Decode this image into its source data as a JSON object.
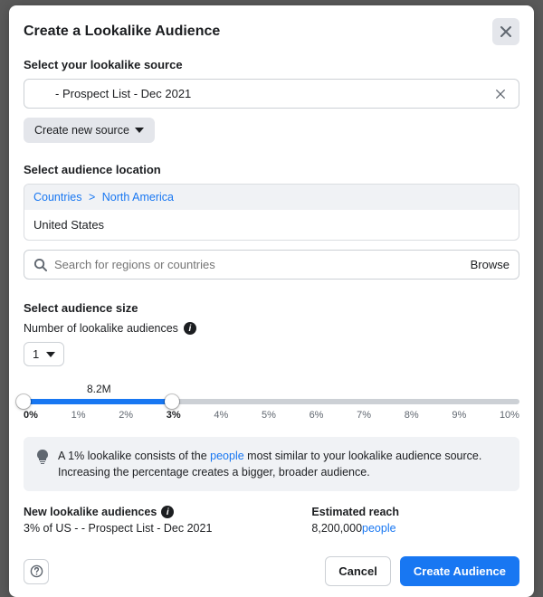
{
  "modal": {
    "title": "Create a Lookalike Audience"
  },
  "source": {
    "label": "Select your lookalike source",
    "value": "- Prospect List - Dec 2021",
    "create_label": "Create new source"
  },
  "location": {
    "label": "Select audience location",
    "breadcrumb_countries": "Countries",
    "breadcrumb_region": "North America",
    "country": "United States",
    "search_placeholder": "Search for regions or countries",
    "browse": "Browse"
  },
  "size": {
    "label": "Select audience size",
    "count_label": "Number of lookalike audiences",
    "count_value": "1",
    "slider_value": "8.2M",
    "ticks": [
      "0%",
      "1%",
      "2%",
      "3%",
      "4%",
      "5%",
      "6%",
      "7%",
      "8%",
      "9%",
      "10%"
    ]
  },
  "note": {
    "pre": "A 1% lookalike consists of the ",
    "link": "people",
    "post": " most similar to your lookalike audience source. Increasing the percentage creates a bigger, broader audience."
  },
  "result": {
    "new_label": "New lookalike audiences",
    "new_value": "3% of US -      - Prospect List - Dec 2021",
    "reach_label": "Estimated reach",
    "reach_value": "8,200,000",
    "reach_word": "people"
  },
  "footer": {
    "cancel": "Cancel",
    "submit": "Create Audience"
  }
}
